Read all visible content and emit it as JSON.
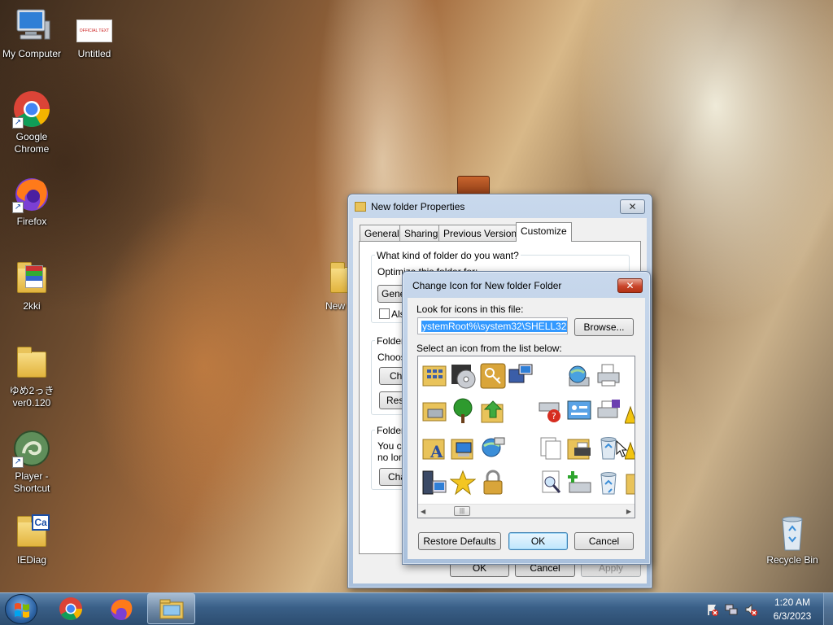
{
  "desktop": {
    "icons": [
      {
        "label": "My Computer",
        "icon": "computer-icon"
      },
      {
        "label": "Untitled",
        "icon": "document-thumbnail-icon"
      },
      {
        "label": "Google Chrome",
        "icon": "chrome-icon"
      },
      {
        "label": "Firefox",
        "icon": "firefox-icon"
      },
      {
        "label": "2kki",
        "icon": "game-folder-icon"
      },
      {
        "label": "ゆめ2っき ver0.120",
        "icon": "folder-icon"
      },
      {
        "label": "Player - Shortcut",
        "icon": "player-icon"
      },
      {
        "label": "IEDiag",
        "icon": "iediag-folder-icon"
      },
      {
        "label": "Recycle Bin",
        "icon": "recycle-bin-icon"
      },
      {
        "label": "New",
        "icon": "folder-icon"
      }
    ],
    "untitled_thumb_text": "OFFICIAL TEXT"
  },
  "properties_window": {
    "title": "New folder Properties",
    "tabs": [
      "General",
      "Sharing",
      "Previous Versions",
      "Customize"
    ],
    "active_tab": "Customize",
    "question": "What kind of folder do you want?",
    "optimize_partial": "Optimize this folder for:",
    "general_btn_partial": "Gene",
    "also_partial": "Als",
    "folder_pictures_partial": "Folder",
    "choose_partial": "Choos",
    "cho_btn_partial": "Cho",
    "res_btn_partial": "Res",
    "folder_icons_partial": "Folder",
    "youca_partial": "You ca",
    "nolon_partial": "no lon",
    "cha_btn_partial": "Cha",
    "ok": "OK",
    "cancel": "Cancel",
    "apply": "Apply"
  },
  "change_icon_dialog": {
    "title": "Change Icon for New folder Folder",
    "look_label": "Look for icons in this file:",
    "file_path": "ystemRoot%\\system32\\SHELL32.dll",
    "browse": "Browse...",
    "select_label": "Select an icon from the list below:",
    "restore": "Restore Defaults",
    "ok": "OK",
    "cancel": "Cancel"
  },
  "taskbar": {
    "time": "1:20 AM",
    "date": "6/3/2023"
  },
  "colors": {
    "taskbar": "#3a5f87",
    "selection": "#3399ff",
    "title_frame": "#b9cde5",
    "close_red": "#c9452a"
  }
}
